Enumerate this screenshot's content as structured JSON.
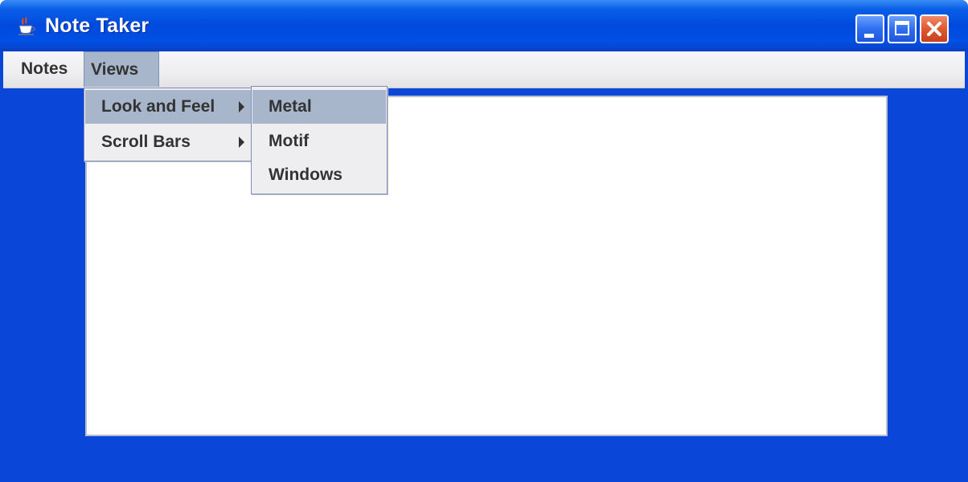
{
  "window": {
    "title": "Note Taker",
    "icon": "java-cup-icon",
    "controls": [
      "minimize-icon",
      "maximize-icon",
      "close-icon"
    ]
  },
  "menubar": {
    "items": [
      {
        "label": "Notes",
        "open": false
      },
      {
        "label": "Views",
        "open": true
      }
    ]
  },
  "views_menu": {
    "items": [
      {
        "label": "Look and Feel",
        "has_submenu": true,
        "selected": true
      },
      {
        "label": "Scroll Bars",
        "has_submenu": true,
        "selected": false
      }
    ]
  },
  "look_and_feel_menu": {
    "items": [
      {
        "label": "Metal",
        "selected": true
      },
      {
        "label": "Motif",
        "selected": false
      },
      {
        "label": "Windows",
        "selected": false
      }
    ]
  },
  "editor": {
    "text": ""
  },
  "colors": {
    "window_background": "#0a46d8",
    "selection": "#a8b6cc",
    "menu_background": "#eeeef0"
  }
}
